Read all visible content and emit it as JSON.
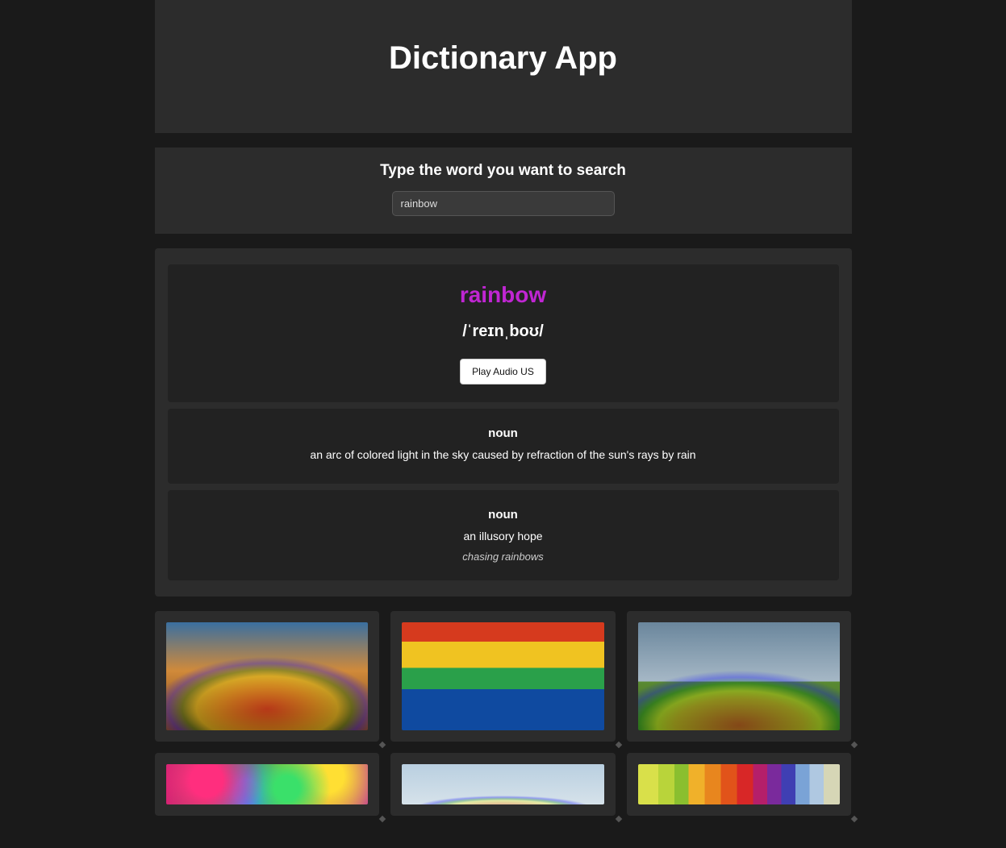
{
  "header": {
    "title": "Dictionary App"
  },
  "search": {
    "label": "Type the word you want to search",
    "value": "rainbow"
  },
  "result": {
    "word": "rainbow",
    "phonetic": "/ˈreɪnˌboʊ/",
    "audio_button": "Play Audio US",
    "definitions": [
      {
        "partOfSpeech": "noun",
        "definition": "an arc of colored light in the sky caused by refraction of the sun's rays by rain",
        "example": ""
      },
      {
        "partOfSpeech": "noun",
        "definition": "an illusory hope",
        "example": "chasing rainbows"
      }
    ]
  },
  "images": [
    {
      "alt": "rainbow-over-boardwalk"
    },
    {
      "alt": "rainbow-painted-stripes"
    },
    {
      "alt": "double-rainbow-field"
    },
    {
      "alt": "rainbow-bokeh-glitter"
    },
    {
      "alt": "faint-rainbow-sky"
    },
    {
      "alt": "rainbow-color-swatches"
    }
  ]
}
